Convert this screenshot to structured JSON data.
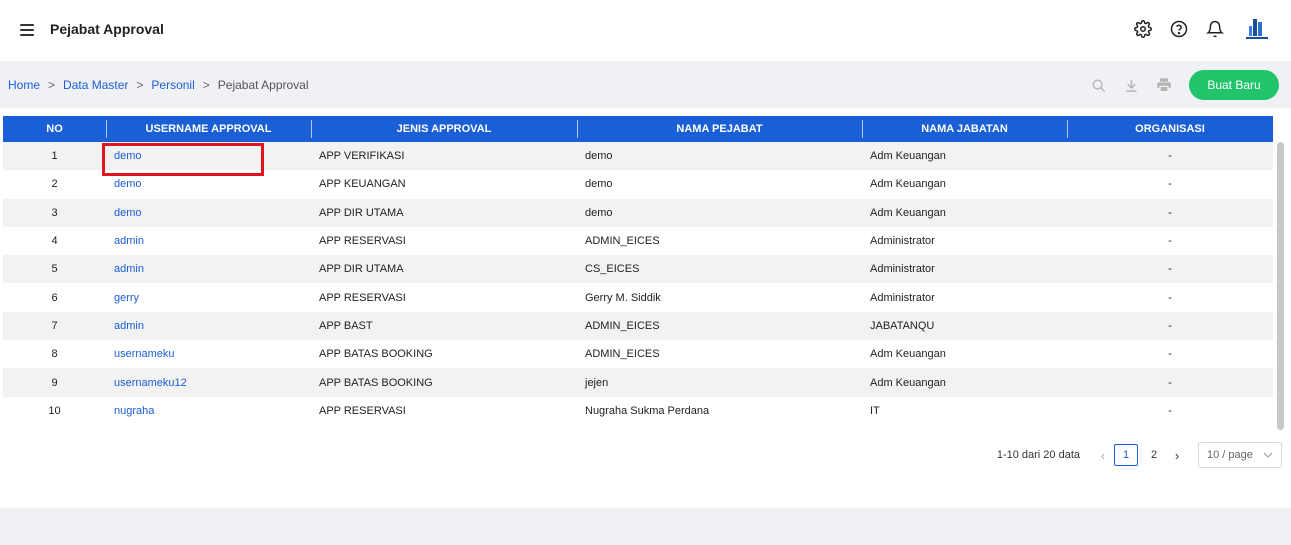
{
  "header": {
    "title": "Pejabat Approval",
    "icons": [
      "menu-icon",
      "gear-icon",
      "help-icon",
      "bell-icon",
      "avatar-logo"
    ]
  },
  "breadcrumb": [
    "Home",
    "Data Master",
    "Personil",
    "Pejabat Approval"
  ],
  "toolbar": {
    "icons": [
      "search-icon",
      "download-icon",
      "print-icon"
    ],
    "new_label": "Buat Baru"
  },
  "table": {
    "columns": [
      "NO",
      "USERNAME APPROVAL",
      "JENIS APPROVAL",
      "NAMA PEJABAT",
      "NAMA JABATAN",
      "ORGANISASI"
    ],
    "rows": [
      {
        "no": "1",
        "username": "demo",
        "jenis": "APP VERIFIKASI",
        "nama": "demo",
        "jabatan": "Adm Keuangan",
        "org": "-"
      },
      {
        "no": "2",
        "username": "demo",
        "jenis": "APP KEUANGAN",
        "nama": "demo",
        "jabatan": "Adm Keuangan",
        "org": "-"
      },
      {
        "no": "3",
        "username": "demo",
        "jenis": "APP DIR UTAMA",
        "nama": "demo",
        "jabatan": "Adm Keuangan",
        "org": "-"
      },
      {
        "no": "4",
        "username": "admin",
        "jenis": "APP RESERVASI",
        "nama": "ADMIN_EICES",
        "jabatan": "Administrator",
        "org": "-"
      },
      {
        "no": "5",
        "username": "admin",
        "jenis": "APP DIR UTAMA",
        "nama": "CS_EICES",
        "jabatan": "Administrator",
        "org": "-"
      },
      {
        "no": "6",
        "username": "gerry",
        "jenis": "APP RESERVASI",
        "nama": "Gerry M. Siddik",
        "jabatan": "Administrator",
        "org": "-"
      },
      {
        "no": "7",
        "username": "admin",
        "jenis": "APP BAST",
        "nama": "ADMIN_EICES",
        "jabatan": "JABATANQU",
        "org": "-"
      },
      {
        "no": "8",
        "username": "usernameku",
        "jenis": "APP BATAS BOOKING",
        "nama": "ADMIN_EICES",
        "jabatan": "Adm Keuangan",
        "org": "-"
      },
      {
        "no": "9",
        "username": "usernameku12",
        "jenis": "APP BATAS BOOKING",
        "nama": "jejen",
        "jabatan": "Adm Keuangan",
        "org": "-"
      },
      {
        "no": "10",
        "username": "nugraha",
        "jenis": "APP RESERVASI",
        "nama": "Nugraha Sukma Perdana",
        "jabatan": "IT",
        "org": "-"
      }
    ]
  },
  "pagination": {
    "info": "1-10 dari 20 data",
    "pages": [
      "1",
      "2"
    ],
    "current_page": "1",
    "page_size": "10 / page"
  },
  "colors": {
    "accent": "#1a5fd6",
    "button": "#21c46b",
    "highlight": "#e0141e"
  }
}
